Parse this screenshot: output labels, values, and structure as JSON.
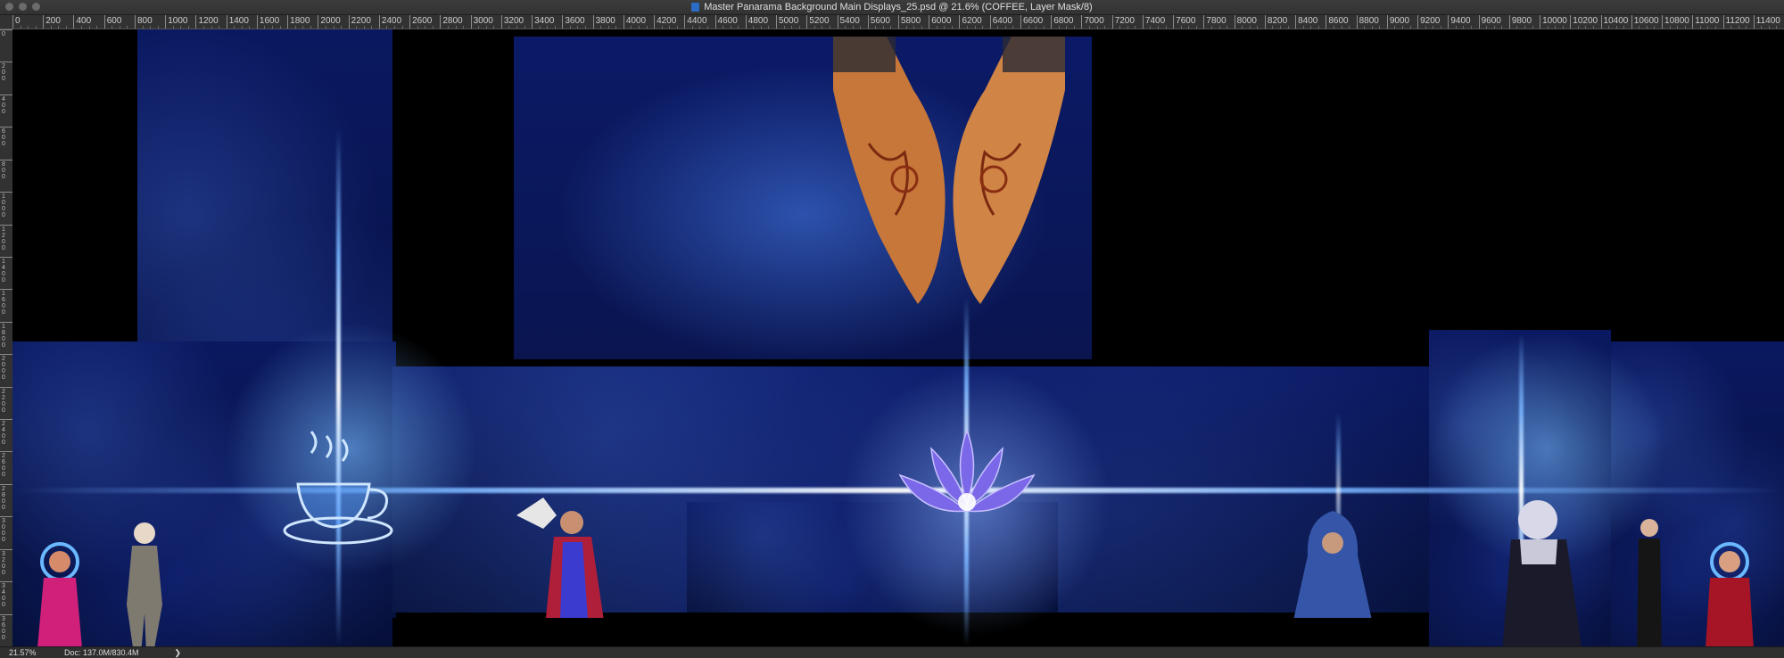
{
  "window": {
    "title": "Master Panarama Background Main Displays_25.psd @ 21.6% (COFFEE, Layer Mask/8)",
    "file_icon": "psd-file-icon"
  },
  "ruler": {
    "horizontal_labels": [
      "0",
      "200",
      "400",
      "600",
      "800",
      "1000",
      "1200",
      "1400",
      "1600",
      "1800",
      "2000",
      "2200",
      "2400",
      "2600",
      "2800",
      "3000",
      "3200",
      "3400",
      "3600",
      "3800",
      "4000",
      "4200",
      "4400",
      "4600",
      "4800",
      "5000",
      "5200",
      "5400",
      "5600",
      "5800",
      "6000",
      "6200",
      "6400",
      "6600",
      "6800",
      "7000",
      "7200",
      "7400",
      "7600",
      "7800",
      "8000",
      "8200",
      "8400",
      "8600",
      "8800",
      "9000",
      "9200",
      "9400",
      "9600",
      "9800",
      "10000",
      "10200",
      "10400",
      "10600",
      "10800",
      "11000",
      "11200",
      "11400",
      "116"
    ],
    "vertical_labels": [
      "0",
      "200",
      "400",
      "600",
      "800",
      "1000",
      "1200",
      "1400",
      "1600",
      "1800",
      "2000",
      "2200",
      "2400",
      "2600",
      "2800",
      "3000",
      "3200",
      "3400",
      "3600",
      "3800"
    ]
  },
  "status": {
    "zoom": "21.57%",
    "doc": "Doc: 137.0M/830.4M",
    "arrow": "❯"
  },
  "artwork": {
    "elements": [
      "henna-hands",
      "coffee-cup-neon",
      "lotus-flower",
      "woman-red-dress",
      "alien-warrior",
      "sorceress-owl",
      "hooded-figure",
      "vintage-woman",
      "woman-black-dress",
      "woman-red-sweater"
    ],
    "colors": {
      "space_dark": "#081348",
      "beam": "#9fd0ff",
      "canvas_bg": "#000000"
    }
  }
}
